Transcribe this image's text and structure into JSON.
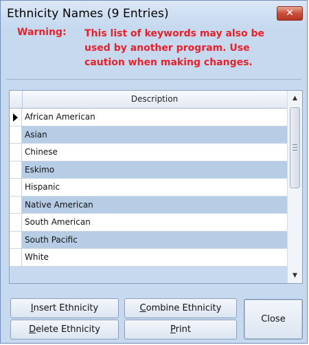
{
  "window": {
    "title": "Ethnicity Names (9 Entries)",
    "close_glyph": "✕"
  },
  "warning": {
    "label": "Warning:",
    "text": "This list of keywords may also be used by another program. Use caution when making changes."
  },
  "grid": {
    "column_header": "Description",
    "selected_row_index": 0,
    "rows": [
      "African American",
      "Asian",
      "Chinese",
      "Eskimo",
      "Hispanic",
      "Native American",
      "South American",
      "South Pacific",
      "White"
    ],
    "scroll_up_glyph": "▲",
    "scroll_down_glyph": "▼"
  },
  "buttons": {
    "insert": {
      "mnemonic": "I",
      "rest": "nsert Ethnicity"
    },
    "combine": {
      "mnemonic": "C",
      "rest": "ombine Ethnicity"
    },
    "delete": {
      "mnemonic": "D",
      "rest": "elete Ethnicity"
    },
    "print": {
      "mnemonic": "P",
      "rest": "rint"
    },
    "close": "Close"
  },
  "colors": {
    "warning": "#e8202a",
    "window_bg": "#c6d9ef",
    "alt_row": "#b7cde6"
  }
}
